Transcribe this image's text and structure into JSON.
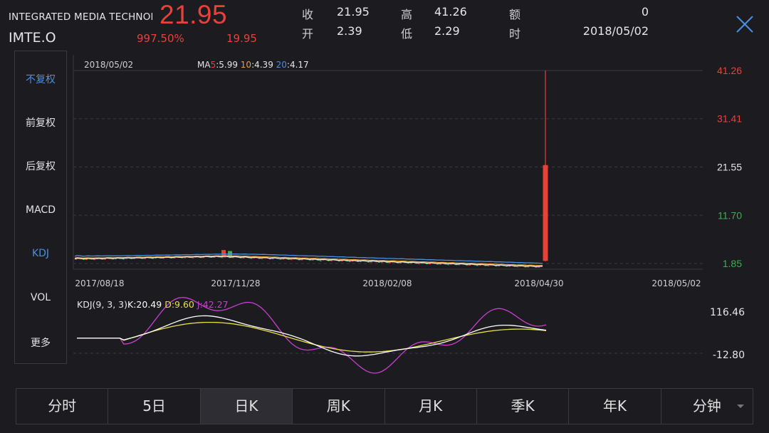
{
  "header": {
    "name": "INTEGRATED MEDIA TECHNOLOGY",
    "code": "IMTE.O",
    "price": "21.95",
    "change_pct": "997.50%",
    "change": "19.95",
    "quote": [
      {
        "label": "收",
        "value": "21.95"
      },
      {
        "label": "高",
        "value": "41.26"
      },
      {
        "label": "额",
        "value": "0"
      },
      {
        "label": "开",
        "value": "2.39"
      },
      {
        "label": "低",
        "value": "2.29"
      },
      {
        "label": "时",
        "value": "2018/05/02"
      }
    ]
  },
  "side_menu": {
    "items": [
      "不复权",
      "前复权",
      "后复权",
      "MACD",
      "KDJ",
      "VOL",
      "更多"
    ],
    "active": [
      "不复权",
      "KDJ"
    ]
  },
  "tabs": {
    "items": [
      "分时",
      "5日",
      "日K",
      "周K",
      "月K",
      "季K",
      "年K",
      "分钟"
    ],
    "active": "日K"
  },
  "colors": {
    "up": "#e8413a",
    "down": "#3fae55",
    "ma5": "#e8e8e8",
    "ma10": "#e8a03c",
    "ma20": "#4a8fe0",
    "kdj_k": "#ffffff",
    "kdj_d": "#e6e04a",
    "kdj_j": "#c83fd0",
    "accent": "#4a8fe0"
  },
  "chart_data": [
    {
      "type": "candlestick",
      "title": "2018/05/02",
      "legend": [
        {
          "name": "MA5",
          "value": "5.99"
        },
        {
          "name": "10",
          "value": "4.39"
        },
        {
          "name": "20",
          "value": "4.17"
        }
      ],
      "y_ticks": [
        "41.26",
        "31.41",
        "21.55",
        "11.70",
        "1.85"
      ],
      "ylim": [
        1.85,
        41.26
      ],
      "x_ticks": [
        "2017/08/18",
        "2017/11/28",
        "2018/02/08",
        "2018/04/30",
        "2018/05/02"
      ],
      "grid": true,
      "last_candle": {
        "date": "2018/05/02",
        "open": 2.39,
        "high": 41.26,
        "low": 2.29,
        "close": 21.95
      }
    },
    {
      "type": "line",
      "title": "KDJ(9, 3, 3)",
      "legend": [
        {
          "name": "K",
          "value": "20.49"
        },
        {
          "name": "D",
          "value": "9.60"
        },
        {
          "name": "J",
          "value": "42.27"
        }
      ],
      "y_ticks": [
        "116.46",
        "-12.80"
      ],
      "ylim": [
        -12.8,
        116.46
      ]
    }
  ]
}
